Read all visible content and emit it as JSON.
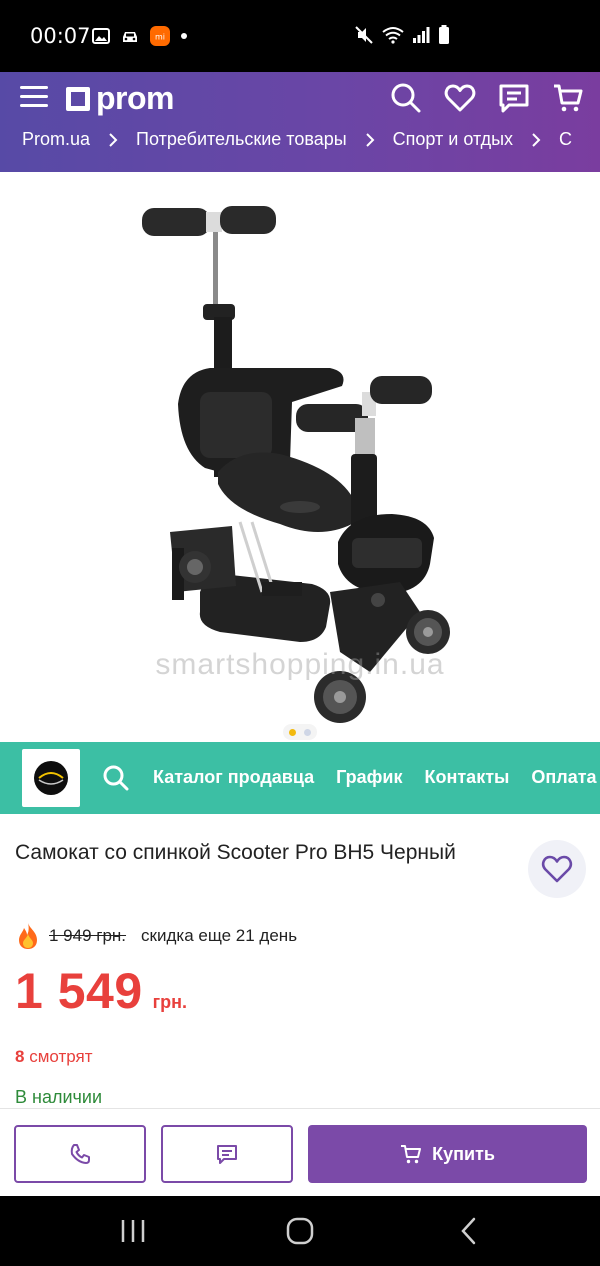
{
  "status_bar": {
    "time": "00:07",
    "icons_left": [
      "image-icon",
      "car-icon",
      "xiaomi-app-icon",
      "dot-icon"
    ],
    "icons_right": [
      "mute-icon",
      "wifi-icon",
      "signal-icon",
      "battery-icon"
    ]
  },
  "header": {
    "logo_text": "prom",
    "icons": [
      "search-icon",
      "heart-icon",
      "chat-icon",
      "cart-icon"
    ],
    "breadcrumbs": [
      "Prom.ua",
      "Потребительские товары",
      "Спорт и отдых",
      "С"
    ]
  },
  "gallery": {
    "watermark": "smartshopping.in.ua",
    "dots": [
      {
        "active": true
      },
      {
        "active": false
      }
    ]
  },
  "seller": {
    "links": [
      "Каталог продавца",
      "График",
      "Контакты",
      "Оплата"
    ]
  },
  "product": {
    "title": "Самокат со спинкой Scooter Pro BH5 Черный",
    "old_price": "1 949 грн.",
    "discount_text": "скидка еще 21 день",
    "price": "1 549",
    "currency": "грн.",
    "watching_count": "8",
    "watching_label": "смотрят",
    "stock": "В наличии"
  },
  "actions": {
    "buy_label": "Купить"
  },
  "colors": {
    "brand_purple": "#7b4aa8",
    "seller_teal": "#3cbfa4",
    "price_red": "#e8403c",
    "stock_green": "#2e8b3a"
  }
}
